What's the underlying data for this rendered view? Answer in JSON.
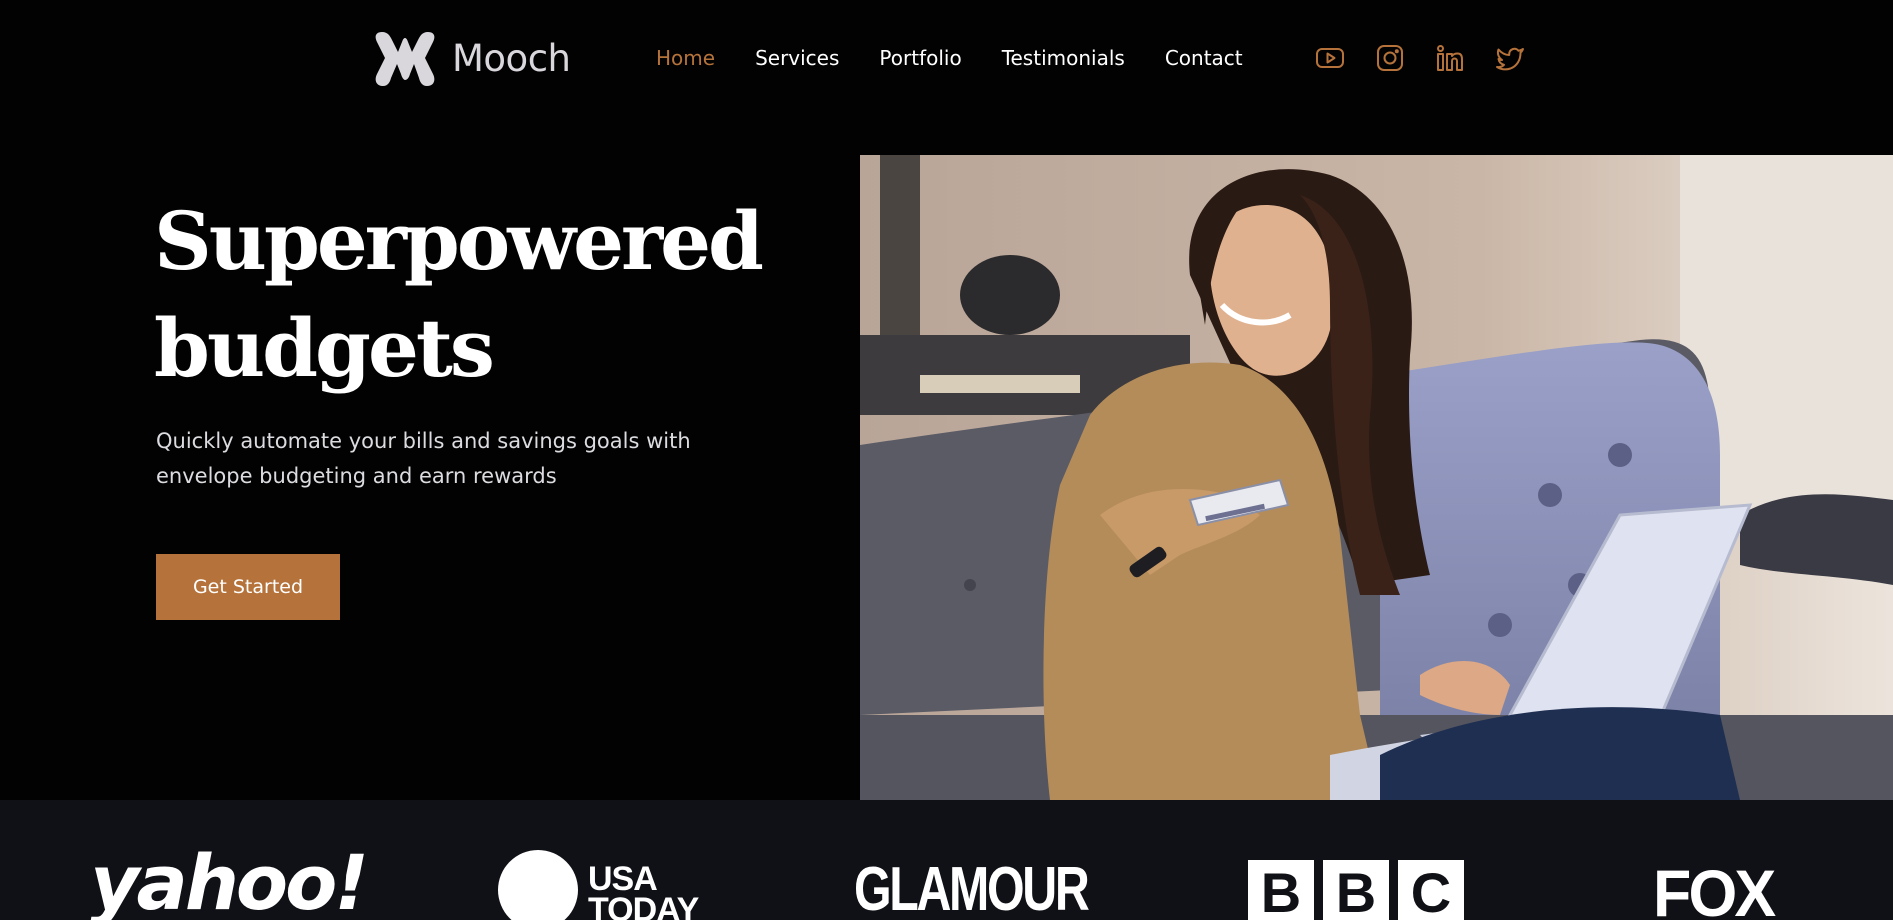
{
  "brand": {
    "name": "Mooch",
    "accent_color": "#b5733b",
    "background_color": "#030202",
    "press_bar_color": "#101116"
  },
  "nav": {
    "items": [
      {
        "label": "Home",
        "active": true
      },
      {
        "label": "Services",
        "active": false
      },
      {
        "label": "Portfolio",
        "active": false
      },
      {
        "label": "Testimonials",
        "active": false
      },
      {
        "label": "Contact",
        "active": false
      }
    ]
  },
  "socials": [
    {
      "icon": "youtube-icon"
    },
    {
      "icon": "instagram-icon"
    },
    {
      "icon": "linkedin-icon"
    },
    {
      "icon": "twitter-icon"
    }
  ],
  "hero": {
    "title_line1": "Superpowered",
    "title_line2": "budgets",
    "subtitle": "Quickly automate your bills and savings goals with envelope budgeting and earn rewards",
    "cta_label": "Get Started",
    "image_icon": "woman-with-card-and-laptop-photo"
  },
  "press": {
    "logos": [
      {
        "text": "yahoo!"
      },
      {
        "line1": "USA",
        "line2": "TODAY"
      },
      {
        "text": "GLAMOUR"
      },
      {
        "letters": [
          "B",
          "B",
          "C"
        ]
      },
      {
        "text": "FOX"
      }
    ]
  }
}
